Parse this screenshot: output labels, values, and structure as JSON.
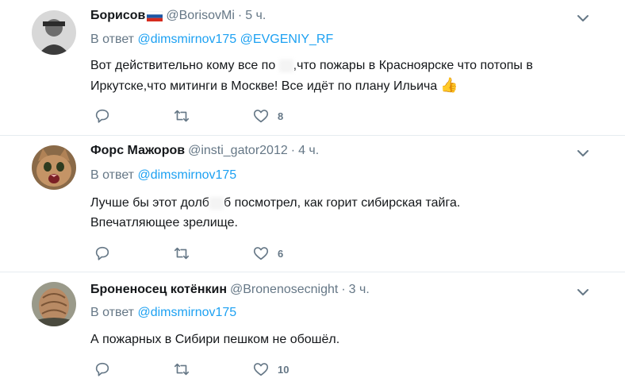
{
  "tweets": [
    {
      "name": "Борисов",
      "handle": "@BorisovMi",
      "dot": "·",
      "time": "5 ч.",
      "reply_prefix": "В ответ",
      "reply_to": [
        "@dimsmirnov175",
        "@EVGENIY_RF"
      ],
      "text_part1": "Вот действительно кому все по ",
      "text_part2": ",что пожары в Красноярске что потопы в Иркутске,что митинги в Москве! Все идёт по плану Ильича",
      "emoji": "👍",
      "like_count": "8"
    },
    {
      "name": "Форс Мажоров",
      "handle": "@insti_gator2012",
      "dot": "·",
      "time": "4 ч.",
      "reply_prefix": "В ответ",
      "reply_to": [
        "@dimsmirnov175"
      ],
      "text_part1": "Лучше бы этот долб",
      "text_part2": "б посмотрел, как горит сибирская тайга. Впечатляющее зрелище.",
      "like_count": "6"
    },
    {
      "name": "Броненосец котёнкин",
      "handle": "@Bronenosecnight",
      "dot": "·",
      "time": "3 ч.",
      "reply_prefix": "В ответ",
      "reply_to": [
        "@dimsmirnov175"
      ],
      "text": "А пожарных в Сибири пешком не обошёл.",
      "like_count": "10"
    }
  ],
  "colors": {
    "link": "#1da1f2",
    "muted": "#657786",
    "divider": "#e6ecf0"
  },
  "icons": [
    "reply-icon",
    "retweet-icon",
    "like-icon",
    "chevron-down-icon",
    "flag-icon",
    "thumbs-up-icon"
  ]
}
